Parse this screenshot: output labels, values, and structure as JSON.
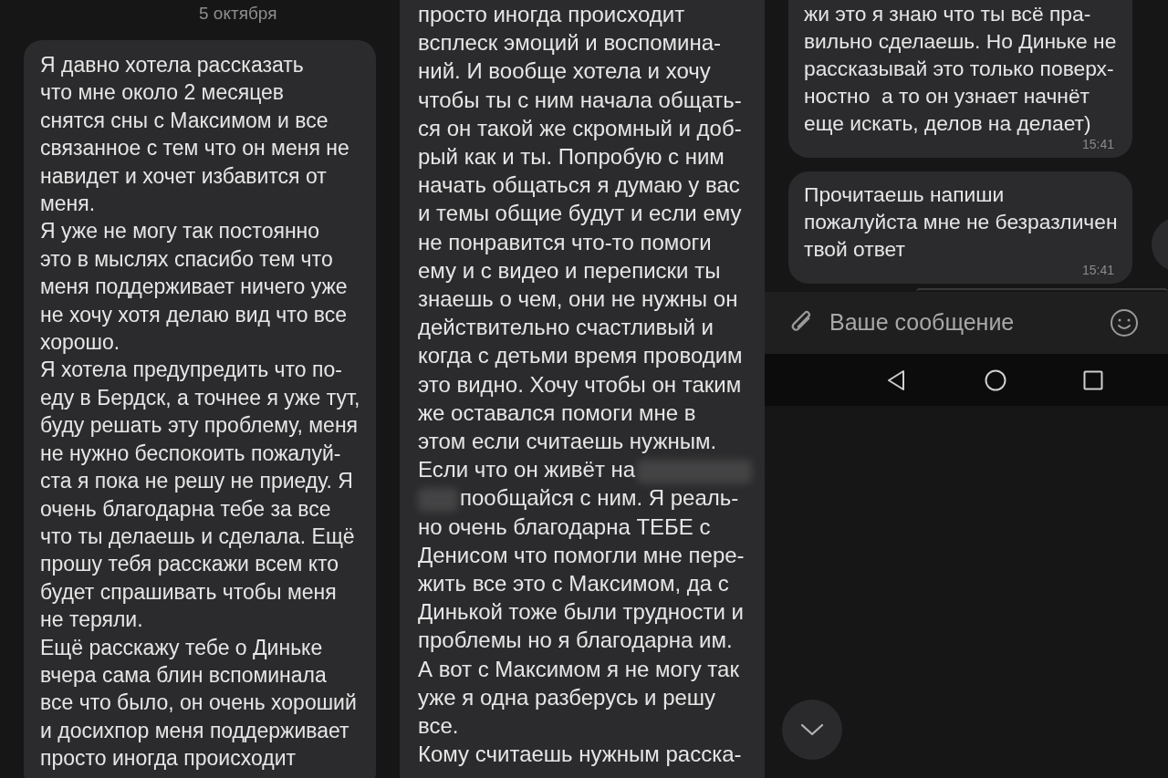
{
  "left_panel": {
    "date": "5 октября",
    "messages": [
      {
        "segments": [
          {
            "kind": "text",
            "text": "Я давно хотела рассказать\nчто мне около 2 месяцев\nснятся сны с Максимом и все\nсвязанное с тем что он меня не\nнавидет и хочет избавится от\nменя.\nЯ уже не могу так постоянно\nэто в мыслях спасибо тем что\nменя поддерживает ничего уже\nне хочу хотя делаю вид что все\nхорошо.\nЯ хотела предупредить что по-\nеду в Бердск, а точнее я уже тут,\nбуду решать эту проблему, меня\nне нужно беспокоить пожалуй-\nста я пока не решу не приеду. Я\nочень благодарна тебе за все\nчто ты делаешь и сделала. Ещё\nпрошу тебя расскажи всем кто\nбудет спрашивать чтобы меня\nне теряли.\nЕщё расскажу тебе о Диньке\nвчера сама блин вспоминала\nвсе что было, он очень хороший\nи досихпор меня поддерживает\nпросто иногда происходит"
          }
        ]
      }
    ]
  },
  "middle_panel": {
    "messages": [
      {
        "segments": [
          {
            "kind": "text",
            "text": "просто иногда происходит\nвсплеск эмоций и воспомина-\nний. И вообще хотела и хочу\nчтобы ты с ним начала общать-\nся он такой же скромный и доб-\nрый как и ты. Попробую с ним\nначать общаться я думаю у вас\nи темы общие будут и если ему\nне понравится что-то помоги\nему и с видео и переписки ты\nзнаешь о чем, они не нужны он\nдействительно счастливый и\nкогда с детьми время проводим\nэто видно. Хочу чтобы он таким\nже оставался помоги мне в\nэтом если считаешь нужным.\nЕсли что он живёт на"
          },
          {
            "kind": "redacted"
          },
          {
            "kind": "line_break"
          },
          {
            "kind": "redacted"
          },
          {
            "kind": "text",
            "text": "пообщайся с ним. Я реаль-\nно очень благодарна ТЕБЕ с\nДенисом что помогли мне пере-\nжить все это с Максимом, да с\nДинькой тоже были трудности и\nпроблемы но я благодарна им.\nА вот с Максимом я не могу так\nуже я одна разберусь и решу\nвсе.\nКому считаешь нужным расска-"
          }
        ]
      }
    ]
  },
  "right_panel": {
    "messages": [
      {
        "segments": [
          {
            "kind": "text",
            "text": "жи это я знаю что ты всё пра-\nвильно сделаешь. Но Диньке не\nрассказывай это только поверх-\nностно  а то он узнает начнёт\nеще искать, делов на делает)"
          }
        ],
        "time": "15:41"
      },
      {
        "segments": [
          {
            "kind": "text",
            "text": "Прочитаешь напиши\nпожалуйста мне не безразличен\nтвой ответ"
          }
        ],
        "time": "15:41"
      }
    ],
    "composer": {
      "placeholder": "Ваше сообщение"
    }
  }
}
